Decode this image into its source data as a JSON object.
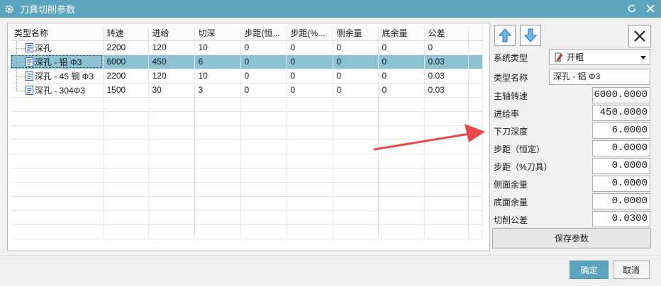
{
  "window": {
    "title": "刀具切削参数",
    "title_bar_color": "#5aa5bd"
  },
  "table": {
    "columns": [
      "类型名称",
      "转速",
      "进给",
      "切深",
      "步距(恒...",
      "步距(%...",
      "侧余量",
      "底余量",
      "公差"
    ],
    "rows": [
      [
        "深孔",
        "2200",
        "120",
        "10",
        "0",
        "0",
        "0",
        "0",
        "0"
      ],
      [
        "深孔 - 铝 Φ3",
        "6000",
        "450",
        "6",
        "0",
        "0",
        "0",
        "0",
        "0.03"
      ],
      [
        "深孔 - 45 钢 Φ3",
        "2200",
        "120",
        "10",
        "0",
        "0",
        "0",
        "0",
        "0.03"
      ],
      [
        "深孔 - 304Φ3",
        "1500",
        "30",
        "3",
        "0",
        "0",
        "0",
        "0",
        "0.03"
      ]
    ],
    "selected_row_index": 1,
    "selected_color": "#8cc3d3"
  },
  "params": {
    "system_type_label": "系统类型",
    "system_type_value": "开粗",
    "type_name_label": "类型名称",
    "type_name_value": "深孔 - 铝 Φ3",
    "fields": [
      {
        "label": "主轴转速",
        "value": "6000.0000"
      },
      {
        "label": "进给率",
        "value": "450.0000"
      },
      {
        "label": "下刀深度",
        "value": "6.0000"
      },
      {
        "label": "步距（恒定）",
        "value": "0.0000"
      },
      {
        "label": "步距（%刀具）",
        "value": "0.0000"
      },
      {
        "label": "侧面余量",
        "value": "0.0000"
      },
      {
        "label": "底面余量",
        "value": "0.0000"
      },
      {
        "label": "切削公差",
        "value": "0.0300"
      }
    ],
    "save_label": "保存参数"
  },
  "footer": {
    "ok_label": "确定",
    "cancel_label": "取消",
    "ok_color": "#5aa5bd"
  },
  "annotation": {
    "arrow_color": "#e8484c"
  }
}
